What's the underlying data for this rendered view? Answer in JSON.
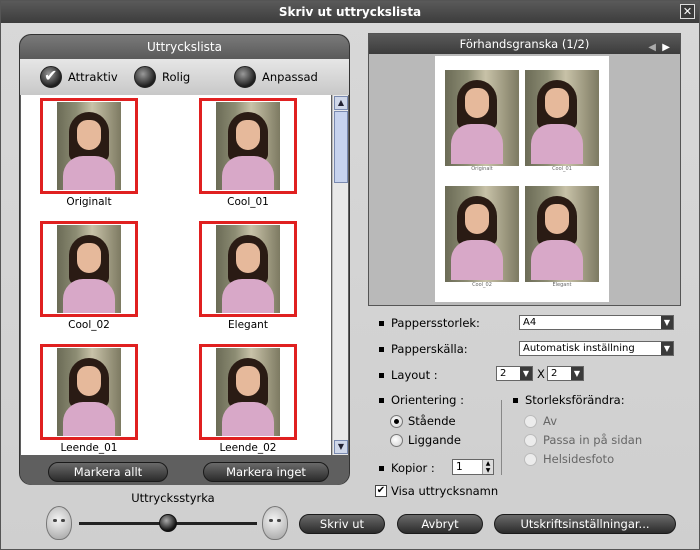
{
  "window": {
    "title": "Skriv ut uttryckslista",
    "close_glyph": "✕"
  },
  "expression_list": {
    "title": "Uttryckslista",
    "options": [
      {
        "label": "Attraktiv",
        "selected": true
      },
      {
        "label": "Rolig",
        "selected": false
      },
      {
        "label": "Anpassad",
        "selected": false
      }
    ],
    "thumbnails": [
      {
        "caption": "Originalt"
      },
      {
        "caption": "Cool_01"
      },
      {
        "caption": "Cool_02"
      },
      {
        "caption": "Elegant"
      },
      {
        "caption": "Leende_01"
      },
      {
        "caption": "Leende_02"
      }
    ],
    "select_all": "Markera allt",
    "select_none": "Markera inget"
  },
  "strength": {
    "label": "Uttrycksstyrka"
  },
  "preview": {
    "title": "Förhandsgranska (1/2)",
    "prev_glyph": "◀",
    "next_glyph": "▶",
    "page_captions": [
      "Originalt",
      "Cool_01",
      "Cool_02",
      "Elegant"
    ]
  },
  "settings": {
    "paper_size_label": "Pappersstorlek:",
    "paper_size_value": "A4",
    "paper_source_label": "Papperskälla:",
    "paper_source_value": "Automatisk inställning",
    "layout_label": "Layout :",
    "layout_cols": "2",
    "layout_x": "X",
    "layout_rows": "2",
    "orientation_label": "Orientering :",
    "orientation_portrait": "Stående",
    "orientation_landscape": "Liggande",
    "resize_label": "Storleksförändra:",
    "resize_off": "Av",
    "resize_fit": "Passa in på sidan",
    "resize_full": "Helsidesfoto",
    "copies_label": "Kopior :",
    "copies_value": "1",
    "show_names_label": "Visa uttrycksnamn",
    "show_names_checked": true,
    "dropdown_glyph": "▼",
    "check_glyph": "✔"
  },
  "buttons": {
    "print": "Skriv ut",
    "cancel": "Avbryt",
    "print_settings": "Utskriftsinställningar..."
  }
}
